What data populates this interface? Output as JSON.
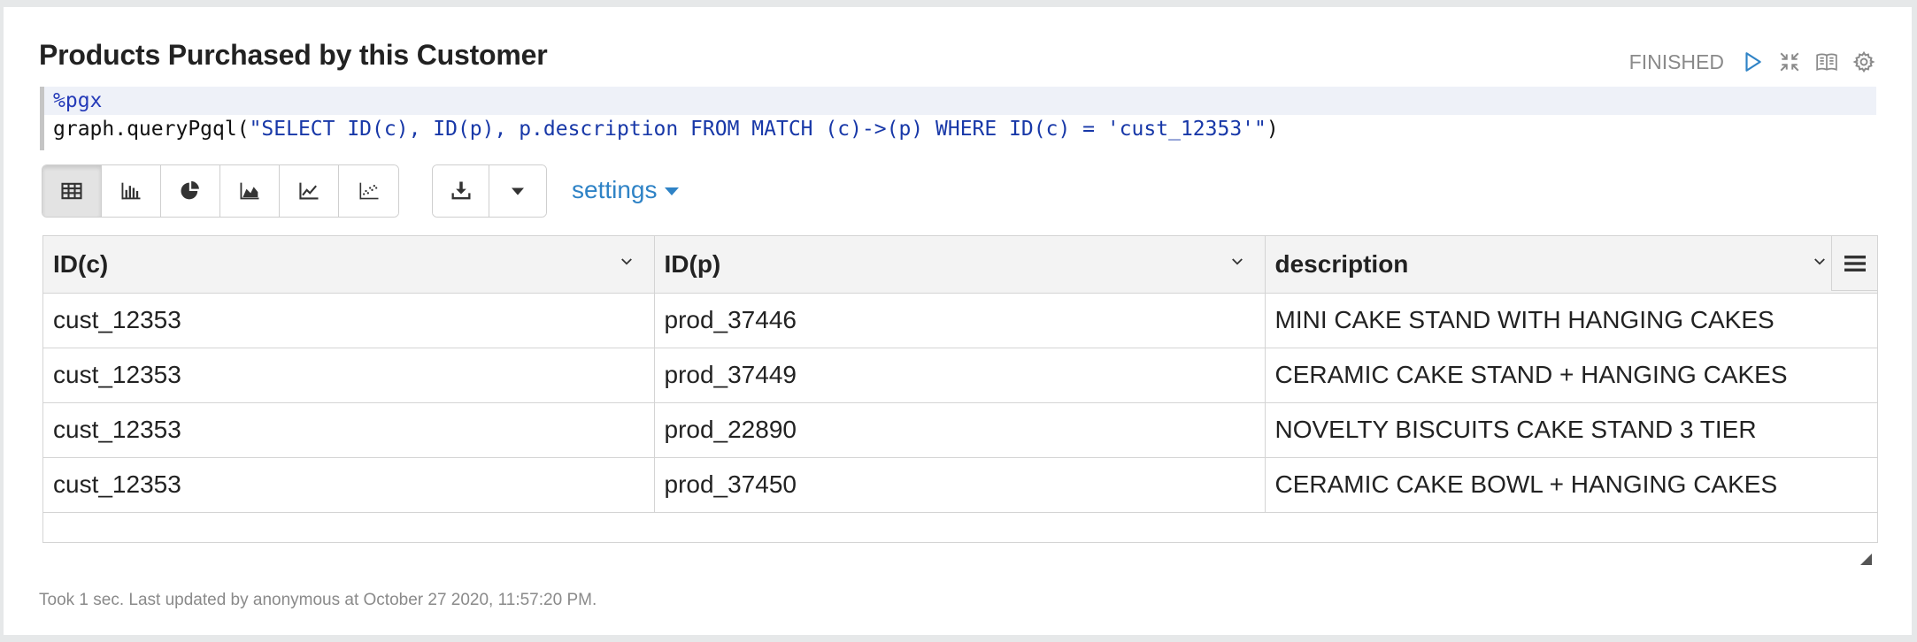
{
  "paragraph": {
    "title": "Products Purchased by this Customer",
    "status": "FINISHED",
    "controls": [
      {
        "icon": "run-icon"
      },
      {
        "icon": "collapse-icon"
      },
      {
        "icon": "book-icon"
      },
      {
        "icon": "gear-icon"
      }
    ]
  },
  "code": {
    "interpreter": "%pgx",
    "line2_prefix": "graph.queryPgql(",
    "line2_string": "\"SELECT ID(c), ID(p), p.description FROM MATCH (c)->(p) WHERE ID(c) = 'cust_12353'\"",
    "line2_suffix": ")"
  },
  "toolbar": {
    "chart_buttons": [
      "table-icon",
      "bar-chart-icon",
      "pie-chart-icon",
      "area-chart-icon",
      "line-chart-icon",
      "scatter-chart-icon"
    ],
    "download_icon": "download-icon",
    "dropdown_icon": "caret-down-icon",
    "settings_label": "settings"
  },
  "table": {
    "columns": [
      "ID(c)",
      "ID(p)",
      "description"
    ],
    "rows": [
      [
        "cust_12353",
        "prod_37446",
        "MINI CAKE STAND WITH HANGING CAKES"
      ],
      [
        "cust_12353",
        "prod_37449",
        "CERAMIC CAKE STAND + HANGING CAKES"
      ],
      [
        "cust_12353",
        "prod_22890",
        "NOVELTY BISCUITS CAKE STAND 3 TIER"
      ],
      [
        "cust_12353",
        "prod_37450",
        "CERAMIC CAKE BOWL + HANGING CAKES"
      ]
    ]
  },
  "footer": {
    "text": "Took 1 sec. Last updated by anonymous at October 27 2020, 11:57:20 PM."
  },
  "colors": {
    "accent": "#2f83c6",
    "status_gray": "#8a8a8a",
    "code_keyword": "#243ab8"
  }
}
